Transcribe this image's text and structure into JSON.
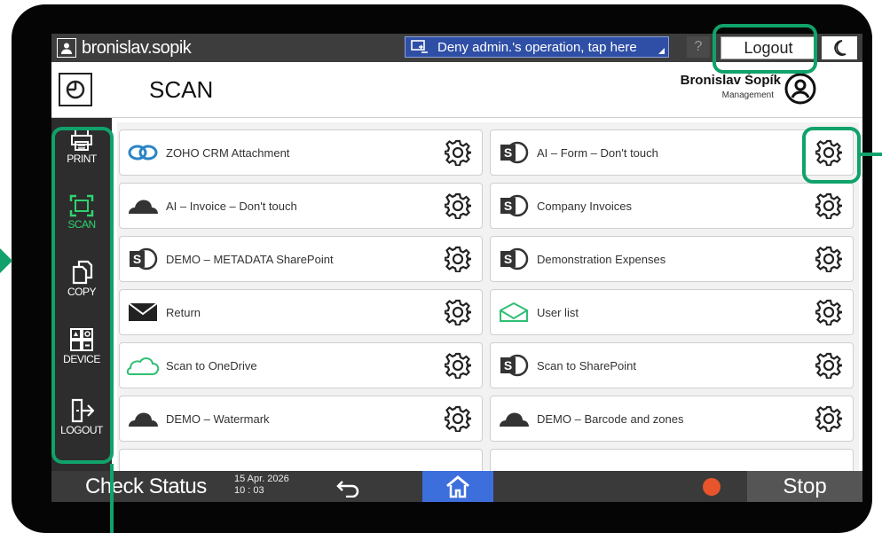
{
  "topbar": {
    "user_name": "bronislav.sopik",
    "deny_label": "Deny admin.'s operation, tap here",
    "help_label": "?",
    "logout_label": "Logout"
  },
  "header": {
    "page_title": "SCAN",
    "account_name": "Bronislav Šopík",
    "account_role": "Management"
  },
  "sidebar": {
    "items": [
      {
        "label": "PRINT",
        "icon": "printer-icon"
      },
      {
        "label": "SCAN",
        "icon": "scan-icon",
        "active": true
      },
      {
        "label": "COPY",
        "icon": "copy-icon"
      },
      {
        "label": "DEVICE",
        "icon": "device-icon"
      },
      {
        "label": "LOGOUT",
        "icon": "logout-icon"
      }
    ]
  },
  "workflows": {
    "left": [
      {
        "label": "ZOHO CRM Attachment",
        "icon": "zoho-icon"
      },
      {
        "label": "AI – Invoice – Don't touch",
        "icon": "cloud-icon"
      },
      {
        "label": "DEMO – METADATA SharePoint",
        "icon": "sharepoint-icon"
      },
      {
        "label": "Return",
        "icon": "envelope-icon"
      },
      {
        "label": "Scan to OneDrive",
        "icon": "onedrive-icon"
      },
      {
        "label": "DEMO – Watermark",
        "icon": "cloud-icon"
      }
    ],
    "right": [
      {
        "label": "AI – Form – Don't touch",
        "icon": "sharepoint-icon"
      },
      {
        "label": "Company Invoices",
        "icon": "sharepoint-icon"
      },
      {
        "label": "Demonstration Expenses",
        "icon": "sharepoint-icon"
      },
      {
        "label": "User list",
        "icon": "envelope-icon"
      },
      {
        "label": "Scan to SharePoint",
        "icon": "sharepoint-icon"
      },
      {
        "label": "DEMO – Barcode and zones",
        "icon": "cloud-icon"
      }
    ]
  },
  "bottombar": {
    "check_status": "Check Status",
    "date": "15 Apr. 2026",
    "time": "10 : 03",
    "stop_label": "Stop"
  },
  "colors": {
    "accent_green": "#10a26a",
    "active_green": "#2fd26f",
    "home_blue": "#3d6fdc",
    "deny_blue": "#2f4fa6",
    "stop_orange": "#e8542c"
  }
}
